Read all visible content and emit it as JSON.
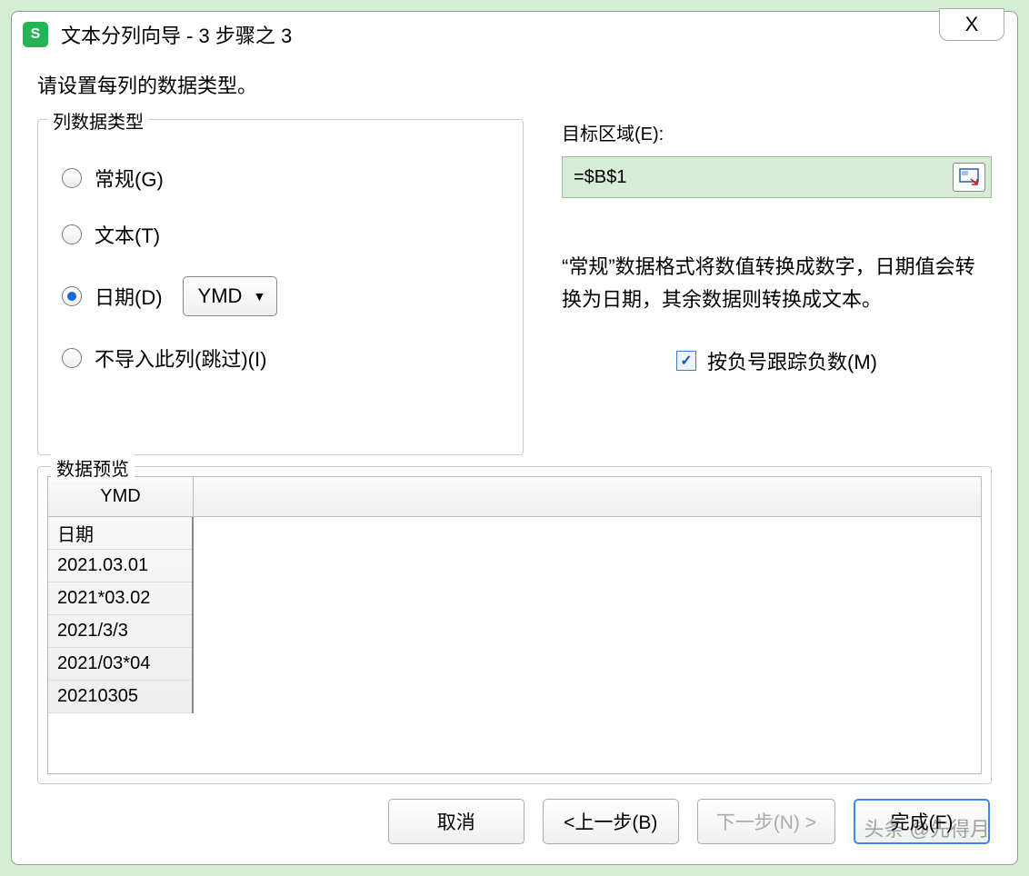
{
  "title": "文本分列向导 - 3 步骤之 3",
  "close_symbol": "X",
  "instruction": "请设置每列的数据类型。",
  "column_type": {
    "legend": "列数据类型",
    "options": {
      "general": "常规(G)",
      "text": "文本(T)",
      "date": "日期(D)",
      "skip": "不导入此列(跳过)(I)"
    },
    "date_format": "YMD",
    "selected": "date"
  },
  "destination": {
    "label": "目标区域(E):",
    "value": "=$B$1"
  },
  "help_text": "“常规”数据格式将数值转换成数字，日期值会转换为日期，其余数据则转换成文本。",
  "track_negative": {
    "label": "按负号跟踪负数(M)",
    "checked": true
  },
  "preview": {
    "legend": "数据预览",
    "header": "YMD",
    "rows": [
      "日期",
      "2021.03.01",
      "2021*03.02",
      "2021/3/3",
      "2021/03*04",
      "20210305"
    ]
  },
  "buttons": {
    "cancel": "取消",
    "back": "<上一步(B)",
    "next": "下一步(N) >",
    "finish": "完成(F)"
  },
  "watermark": "头条 @先得月"
}
